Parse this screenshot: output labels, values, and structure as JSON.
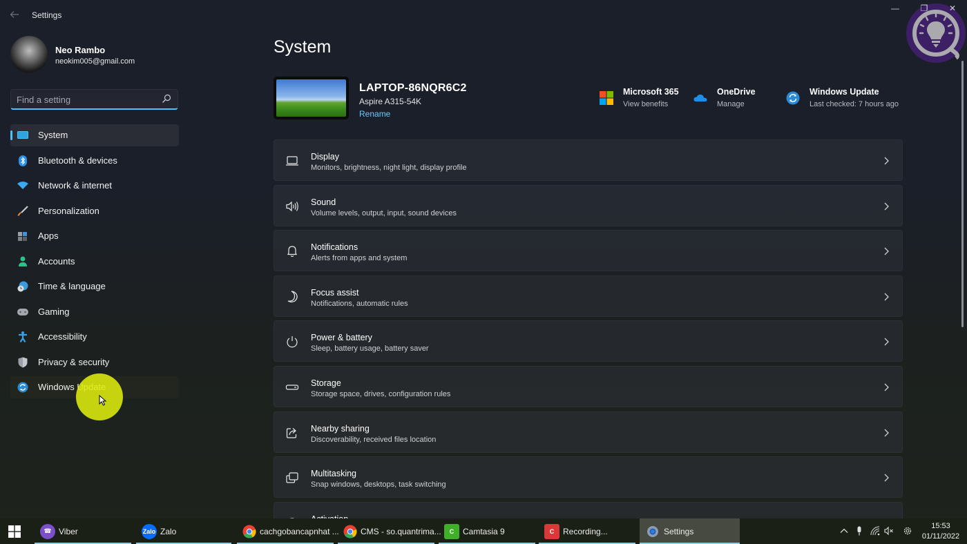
{
  "window": {
    "title": "Settings",
    "back_icon": "arrow-left-icon",
    "controls": {
      "minimize": "—",
      "maximize": "❐",
      "close": "✕"
    }
  },
  "watermark": {
    "icon": "lightbulb-icon"
  },
  "profile": {
    "name": "Neo Rambo",
    "email": "neokim005@gmail.com"
  },
  "search": {
    "placeholder": "Find a setting",
    "value": ""
  },
  "sidebar": {
    "items": [
      {
        "label": "System",
        "icon": "monitor-icon",
        "active": true
      },
      {
        "label": "Bluetooth & devices",
        "icon": "bluetooth-icon"
      },
      {
        "label": "Network & internet",
        "icon": "wifi-icon"
      },
      {
        "label": "Personalization",
        "icon": "brush-icon"
      },
      {
        "label": "Apps",
        "icon": "apps-icon"
      },
      {
        "label": "Accounts",
        "icon": "person-icon"
      },
      {
        "label": "Time & language",
        "icon": "globe-clock-icon"
      },
      {
        "label": "Gaming",
        "icon": "gamepad-icon"
      },
      {
        "label": "Accessibility",
        "icon": "accessibility-icon"
      },
      {
        "label": "Privacy & security",
        "icon": "shield-icon"
      },
      {
        "label": "Windows Update",
        "icon": "sync-icon",
        "hovered": true
      }
    ]
  },
  "main": {
    "title": "System",
    "device": {
      "name": "LAPTOP-86NQR6C2",
      "model": "Aspire A315-54K",
      "rename_label": "Rename"
    },
    "quick_links": [
      {
        "title": "Microsoft 365",
        "subtitle": "View benefits",
        "icon": "microsoft-logo-icon"
      },
      {
        "title": "OneDrive",
        "subtitle": "Manage",
        "icon": "cloud-icon"
      },
      {
        "title": "Windows Update",
        "subtitle": "Last checked: 7 hours ago",
        "icon": "sync-icon"
      }
    ],
    "cards": [
      {
        "title": "Display",
        "subtitle": "Monitors, brightness, night light, display profile",
        "icon": "laptop-icon"
      },
      {
        "title": "Sound",
        "subtitle": "Volume levels, output, input, sound devices",
        "icon": "speaker-icon"
      },
      {
        "title": "Notifications",
        "subtitle": "Alerts from apps and system",
        "icon": "bell-icon"
      },
      {
        "title": "Focus assist",
        "subtitle": "Notifications, automatic rules",
        "icon": "moon-icon"
      },
      {
        "title": "Power & battery",
        "subtitle": "Sleep, battery usage, battery saver",
        "icon": "power-icon"
      },
      {
        "title": "Storage",
        "subtitle": "Storage space, drives, configuration rules",
        "icon": "storage-icon"
      },
      {
        "title": "Nearby sharing",
        "subtitle": "Discoverability, received files location",
        "icon": "share-icon"
      },
      {
        "title": "Multitasking",
        "subtitle": "Snap windows, desktops, task switching",
        "icon": "multitask-icon"
      },
      {
        "title": "Activation",
        "subtitle": "",
        "icon": "key-icon"
      }
    ]
  },
  "taskbar": {
    "apps": [
      {
        "label": "Viber",
        "icon": "viber-icon",
        "color": "#7b4fc9"
      },
      {
        "label": "Zalo",
        "icon": "zalo-icon",
        "color": "#0a6cff",
        "icon_text": "Zalo"
      },
      {
        "label": "cachgobancapnhat ...",
        "icon": "chrome-icon"
      },
      {
        "label": "CMS - so.quantrima...",
        "icon": "chrome-icon"
      },
      {
        "label": "Camtasia 9",
        "icon": "camtasia-icon",
        "color": "#3fae29"
      },
      {
        "label": "Recording...",
        "icon": "camtasia-recorder-icon",
        "color": "#d83a3a"
      },
      {
        "label": "Settings",
        "icon": "settings-gear-icon",
        "active": true
      }
    ],
    "tray": {
      "time": "15:53",
      "date": "01/11/2022"
    }
  },
  "colors": {
    "accent": "#4cc2ff",
    "link": "#60cdff",
    "cursor_highlight": "#deec0e"
  }
}
